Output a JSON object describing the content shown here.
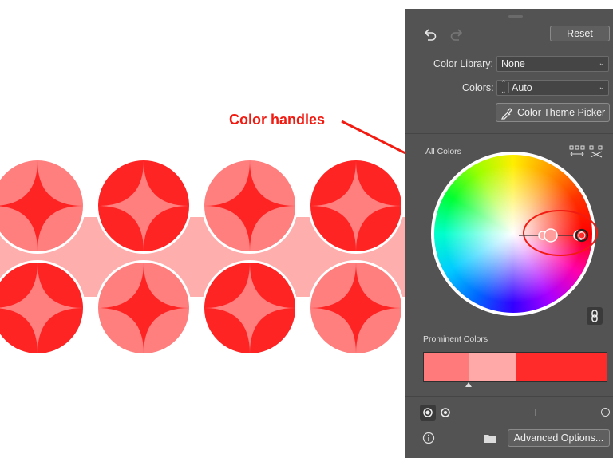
{
  "annotation": {
    "text": "Color handles",
    "color": "#f21b12"
  },
  "panel": {
    "reset_label": "Reset",
    "color_library_label": "Color Library:",
    "color_library_value": "None",
    "colors_label": "Colors:",
    "colors_value": "Auto",
    "theme_picker_label": "Color Theme Picker",
    "all_colors_label": "All Colors",
    "prominent_colors_label": "Prominent Colors",
    "advanced_options_label": "Advanced Options...",
    "prominent_swatches": [
      "#ff7b7b",
      "#ffa9a9",
      "#ff2a2a"
    ]
  },
  "artwork": {
    "colors": {
      "dark_red": "#ff2424",
      "light_red": "#ff7e7e",
      "pale_pink": "#ffaeae"
    }
  }
}
